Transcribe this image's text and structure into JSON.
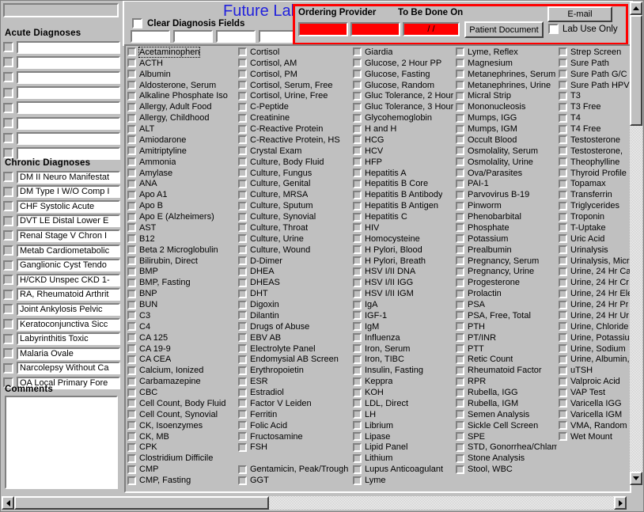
{
  "window": {
    "title": "Future Laboratory Orders",
    "title_color": "#2222dd",
    "accent_red": "#ff0000"
  },
  "left_panel": {
    "patient_bar_value": "",
    "acute_title": "Acute Diagnoses",
    "acute_rows": [
      "",
      "",
      "",
      "",
      "",
      "",
      "",
      ""
    ],
    "chronic_title": "Chronic Diagnoses",
    "chronic_rows": [
      "DM  II Neuro Manifestat",
      "DM  Type I W/O Comp I",
      "CHF Systolic Acute",
      "DVT LE Distal Lower E",
      "Renal  Stage V Chron I",
      "Metab Cardiometabolic",
      "Ganglionic Cyst Tendo",
      "H/CKD Unspec CKD 1-",
      "RA, Rheumatoid Arthrit",
      "Joint Ankylosis Pelvic ",
      "Keratoconjunctiva Sicc",
      "Labyrinthitis Toxic",
      "Malaria Ovale",
      "Narcolepsy Without Ca",
      "OA Local Primary Fore"
    ],
    "comments_title": "Comments",
    "comments_value": ""
  },
  "header": {
    "clear_diagnosis_label": "Clear Diagnosis Fields",
    "clear_diagnosis_checked": false,
    "dx_fields": [
      "",
      "",
      "",
      ""
    ],
    "ordering_provider_label": "Ordering Provider",
    "to_be_done_on_label": "To Be Done On",
    "provider_field_1": "",
    "provider_field_2": "",
    "date_field": "  /  /",
    "patient_document_button": "Patient Document",
    "email_button": "E-mail",
    "lab_use_only_label": "Lab Use Only",
    "lab_use_only_checked": false
  },
  "lab_columns": [
    {
      "items": [
        "Acetaminophen",
        "ACTH",
        "Albumin",
        "Aldosterone, Serum",
        "Alkaline Phosphate Iso",
        "Allergy, Adult Food",
        "Allergy, Childhood",
        "ALT",
        "Amiodarone",
        "Amitriptyline",
        "Ammonia",
        "Amylase",
        "ANA",
        "Apo A1",
        "Apo B",
        "Apo E (Alzheimers)",
        "AST",
        "B12",
        "Beta 2 Microglobulin",
        "Bilirubin, Direct",
        "BMP",
        "BMP, Fasting",
        "BNP",
        "BUN",
        "C3",
        "C4",
        "CA 125",
        "CA 19-9",
        "CA CEA",
        "Calcium, Ionized",
        "Carbamazepine",
        "CBC",
        "Cell Count, Body Fluid",
        "Cell Count, Synovial",
        "CK, Isoenzymes",
        "CK, MB",
        "CPK",
        "Clostridium Difficile",
        "CMP",
        "CMP, Fasting"
      ]
    },
    {
      "items": [
        "Cortisol",
        "Cortisol, AM",
        "Cortisol, PM",
        "Cortisol, Serum, Free",
        "Cortisol, Urine, Free",
        "C-Peptide",
        "Creatinine",
        "C-Reactive Protein",
        "C-Reactive Protein, HS",
        "Crystal Exam",
        "Culture, Body Fluid",
        "Culture, Fungus",
        "Culture, Genital",
        "Culture, MRSA",
        "Culture, Sputum",
        "Culture, Synovial",
        "Culture, Throat",
        "Culture, Urine",
        "Culture, Wound",
        "D-Dimer",
        "DHEA",
        "DHEAS",
        "DHT",
        "Digoxin",
        "Dilantin",
        "Drugs of Abuse",
        "EBV AB",
        "Electrolyte Panel",
        "Endomysial AB Screen",
        "Erythropoietin",
        "ESR",
        "Estradiol",
        "Factor V Leiden",
        "Ferritin",
        "Folic Acid",
        "Fructosamine",
        "FSH",
        "",
        "Gentamicin, Peak/Trough",
        "GGT"
      ]
    },
    {
      "items": [
        "Giardia",
        "Glucose, 2 Hour PP",
        "Glucose, Fasting",
        "Glucose, Random",
        "Gluc Tolerance, 2 Hour",
        "Gluc Tolerance, 3 Hour",
        "Glycohemoglobin",
        "H and H",
        "HCG",
        "HCV",
        "HFP",
        "Hepatitis A",
        "Hepatitis B Core",
        "Hepatitis B Antibody",
        "Hepatitis B Antigen",
        "Hepatitis C",
        "HIV",
        "Homocysteine",
        "H Pylori, Blood",
        "H Pylori, Breath",
        "HSV I/II DNA",
        "HSV I/II IGG",
        "HSV I/II IGM",
        "IgA",
        "IGF-1",
        "IgM",
        "Influenza",
        "Iron, Serum",
        "Iron, TIBC",
        "Insulin, Fasting",
        "Keppra",
        "KOH",
        "LDL, Direct",
        "LH",
        "Librium",
        "Lipase",
        "Lipid Panel",
        "Lithium",
        "Lupus Anticoagulant",
        "Lyme"
      ]
    },
    {
      "items": [
        "Lyme, Reflex",
        "Magnesium",
        "Metanephrines, Serum",
        "Metanephrines, Urine",
        "Micral Strip",
        "Mononucleosis",
        "Mumps, IGG",
        "Mumps, IGM",
        "Occult Blood",
        "Osmolality, Serum",
        "Osmolality, Urine",
        "Ova/Parasites",
        "PAI-1",
        "Parvovirus B-19",
        "Pinworm",
        "Phenobarbital",
        "Phosphate",
        "Potassium",
        "Prealbumin",
        "Pregnancy, Serum",
        "Pregnancy, Urine",
        "Progesterone",
        "Prolactin",
        "PSA",
        "PSA, Free, Total",
        "PTH",
        "PT/INR",
        "PTT",
        "Retic Count",
        "Rheumatoid Factor",
        "RPR",
        "Rubella, IGG",
        "Rubella, IGM",
        "Semen Analysis",
        "Sickle Cell Screen",
        "SPE",
        "STD, Gonorrhea/Chlamydia",
        "Stone Analysis",
        "Stool, WBC"
      ]
    },
    {
      "items": [
        "Strep Screen",
        "Sure Path",
        "Sure Path G/C",
        "Sure Path HPV",
        "T3",
        "T3 Free",
        "T4",
        "T4 Free",
        "Testosterone",
        "Testosterone,",
        "Theophylline",
        "Thyroid Profile",
        "Topamax",
        "Transferrin",
        "Triglycerides",
        "Troponin",
        "T-Uptake",
        "Uric Acid",
        "Urinalysis",
        "Urinalysis, Micr",
        "Urine, 24 Hr Ca",
        "Urine, 24 Hr Cr",
        "Urine, 24 Hr Ele",
        "Urine, 24 Hr Pr",
        "Urine, 24 Hr Ur",
        "Urine, Chloride",
        "Urine, Potassiu",
        "Urine, Sodium",
        "Urine, Albumin,",
        "uTSH",
        "Valproic Acid",
        "VAP Test",
        "Varicella IGG",
        "Varicella IGM",
        "VMA, Random",
        "Wet Mount"
      ]
    }
  ],
  "scrollbars": {
    "vertical_up_icon": "arrow-up-icon",
    "vertical_down_icon": "arrow-down-icon",
    "horizontal_left_icon": "arrow-left-icon",
    "horizontal_right_icon": "arrow-right-icon"
  }
}
